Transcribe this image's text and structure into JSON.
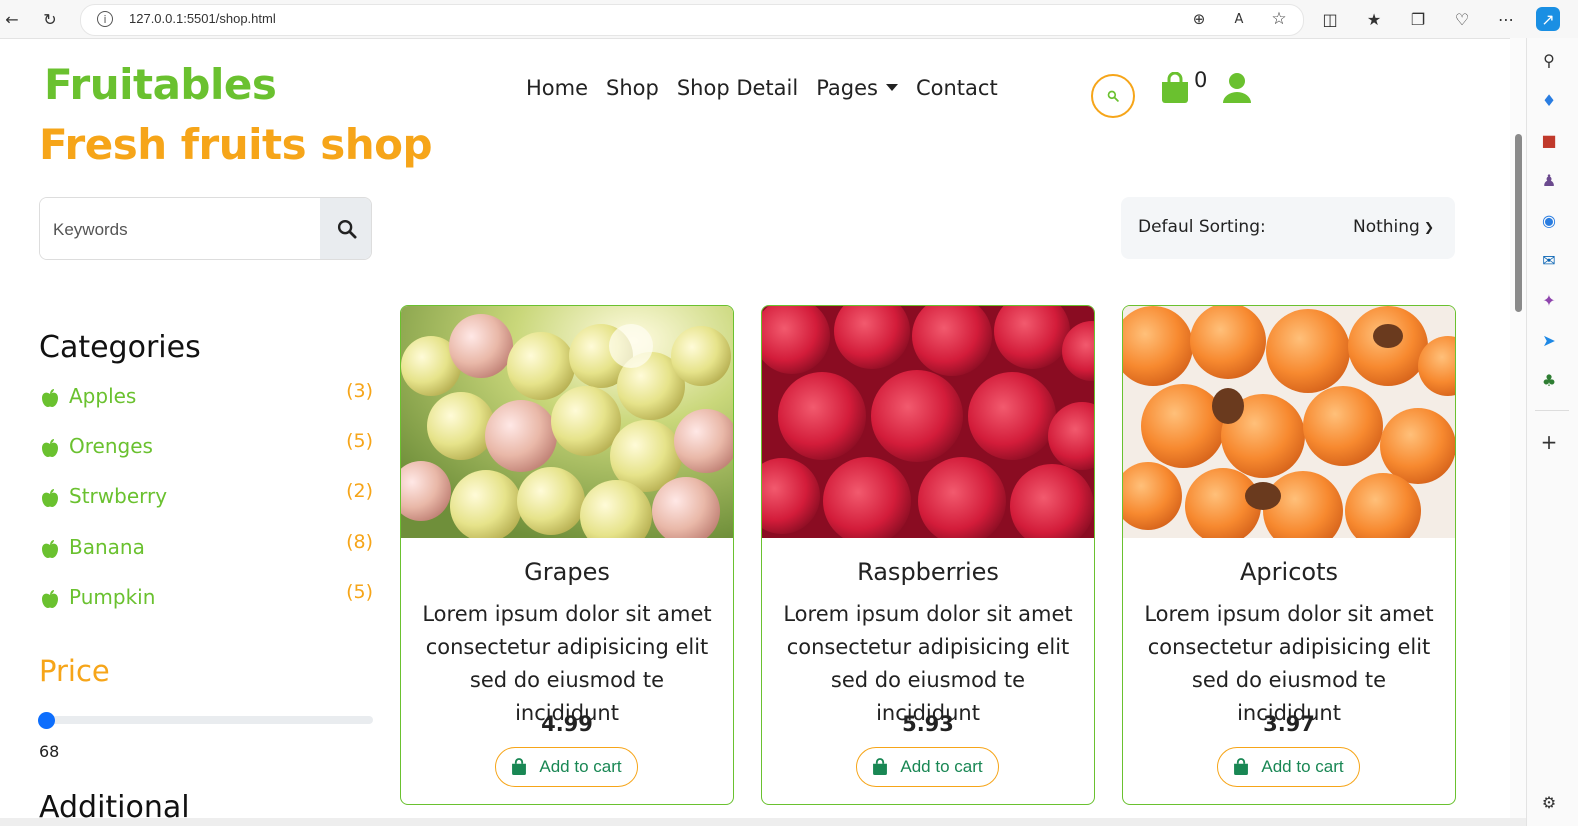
{
  "browser": {
    "url": "127.0.0.1:5501/shop.html"
  },
  "header": {
    "brand": "Fruitables",
    "subtitle": "Fresh fruits shop",
    "nav": [
      "Home",
      "Shop",
      "Shop Detail",
      "Pages",
      "Contact"
    ],
    "cart_count": "0"
  },
  "search": {
    "placeholder": "Keywords"
  },
  "sorting": {
    "label": "Defaul Sorting:",
    "value": "Nothing"
  },
  "categories": {
    "title": "Categories",
    "items": [
      {
        "name": "Apples",
        "count": "(3)"
      },
      {
        "name": "Orenges",
        "count": "(5)"
      },
      {
        "name": "Strwberry",
        "count": "(2)"
      },
      {
        "name": "Banana",
        "count": "(8)"
      },
      {
        "name": "Pumpkin",
        "count": "(5)"
      }
    ]
  },
  "price": {
    "title": "Price",
    "value": "68"
  },
  "additional": {
    "title": "Additional"
  },
  "products": [
    {
      "name": "Grapes",
      "description": "Lorem ipsum dolor sit amet consectetur adipisicing elit sed do eiusmod te incididunt",
      "price": "4.99",
      "button": "Add to cart"
    },
    {
      "name": "Raspberries",
      "description": "Lorem ipsum dolor sit amet consectetur adipisicing elit sed do eiusmod te incididunt",
      "price": "5.93",
      "button": "Add to cart"
    },
    {
      "name": "Apricots",
      "description": "Lorem ipsum dolor sit amet consectetur adipisicing elit sed do eiusmod te incididunt",
      "price": "3.97",
      "button": "Add to cart"
    }
  ],
  "colors": {
    "brand_green": "#6ac12f",
    "accent_orange": "#f6a519",
    "button_green": "#198754"
  }
}
